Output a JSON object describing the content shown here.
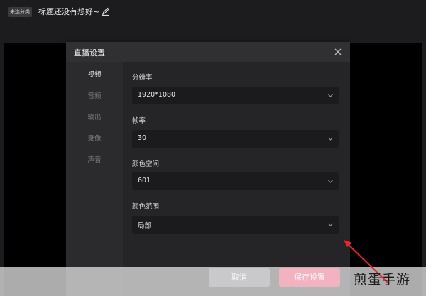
{
  "header": {
    "tag": "未选分类",
    "title": "标题还没有想好~"
  },
  "modal": {
    "title": "直播设置",
    "nav": [
      {
        "label": "视频",
        "active": true
      },
      {
        "label": "音频",
        "active": false
      },
      {
        "label": "输出",
        "active": false
      },
      {
        "label": "录像",
        "active": false
      },
      {
        "label": "声音",
        "active": false
      }
    ],
    "fields": [
      {
        "label": "分辨率",
        "value": "1920*1080"
      },
      {
        "label": "帧率",
        "value": "30"
      },
      {
        "label": "颜色空间",
        "value": "601"
      },
      {
        "label": "颜色范围",
        "value": "局部"
      }
    ],
    "buttons": {
      "cancel": "取消",
      "save": "保存设置"
    }
  },
  "watermark": "煎蛋手游",
  "colors": {
    "save_button": "#f2b2c0",
    "annotation_arrow": "#e8262b"
  }
}
